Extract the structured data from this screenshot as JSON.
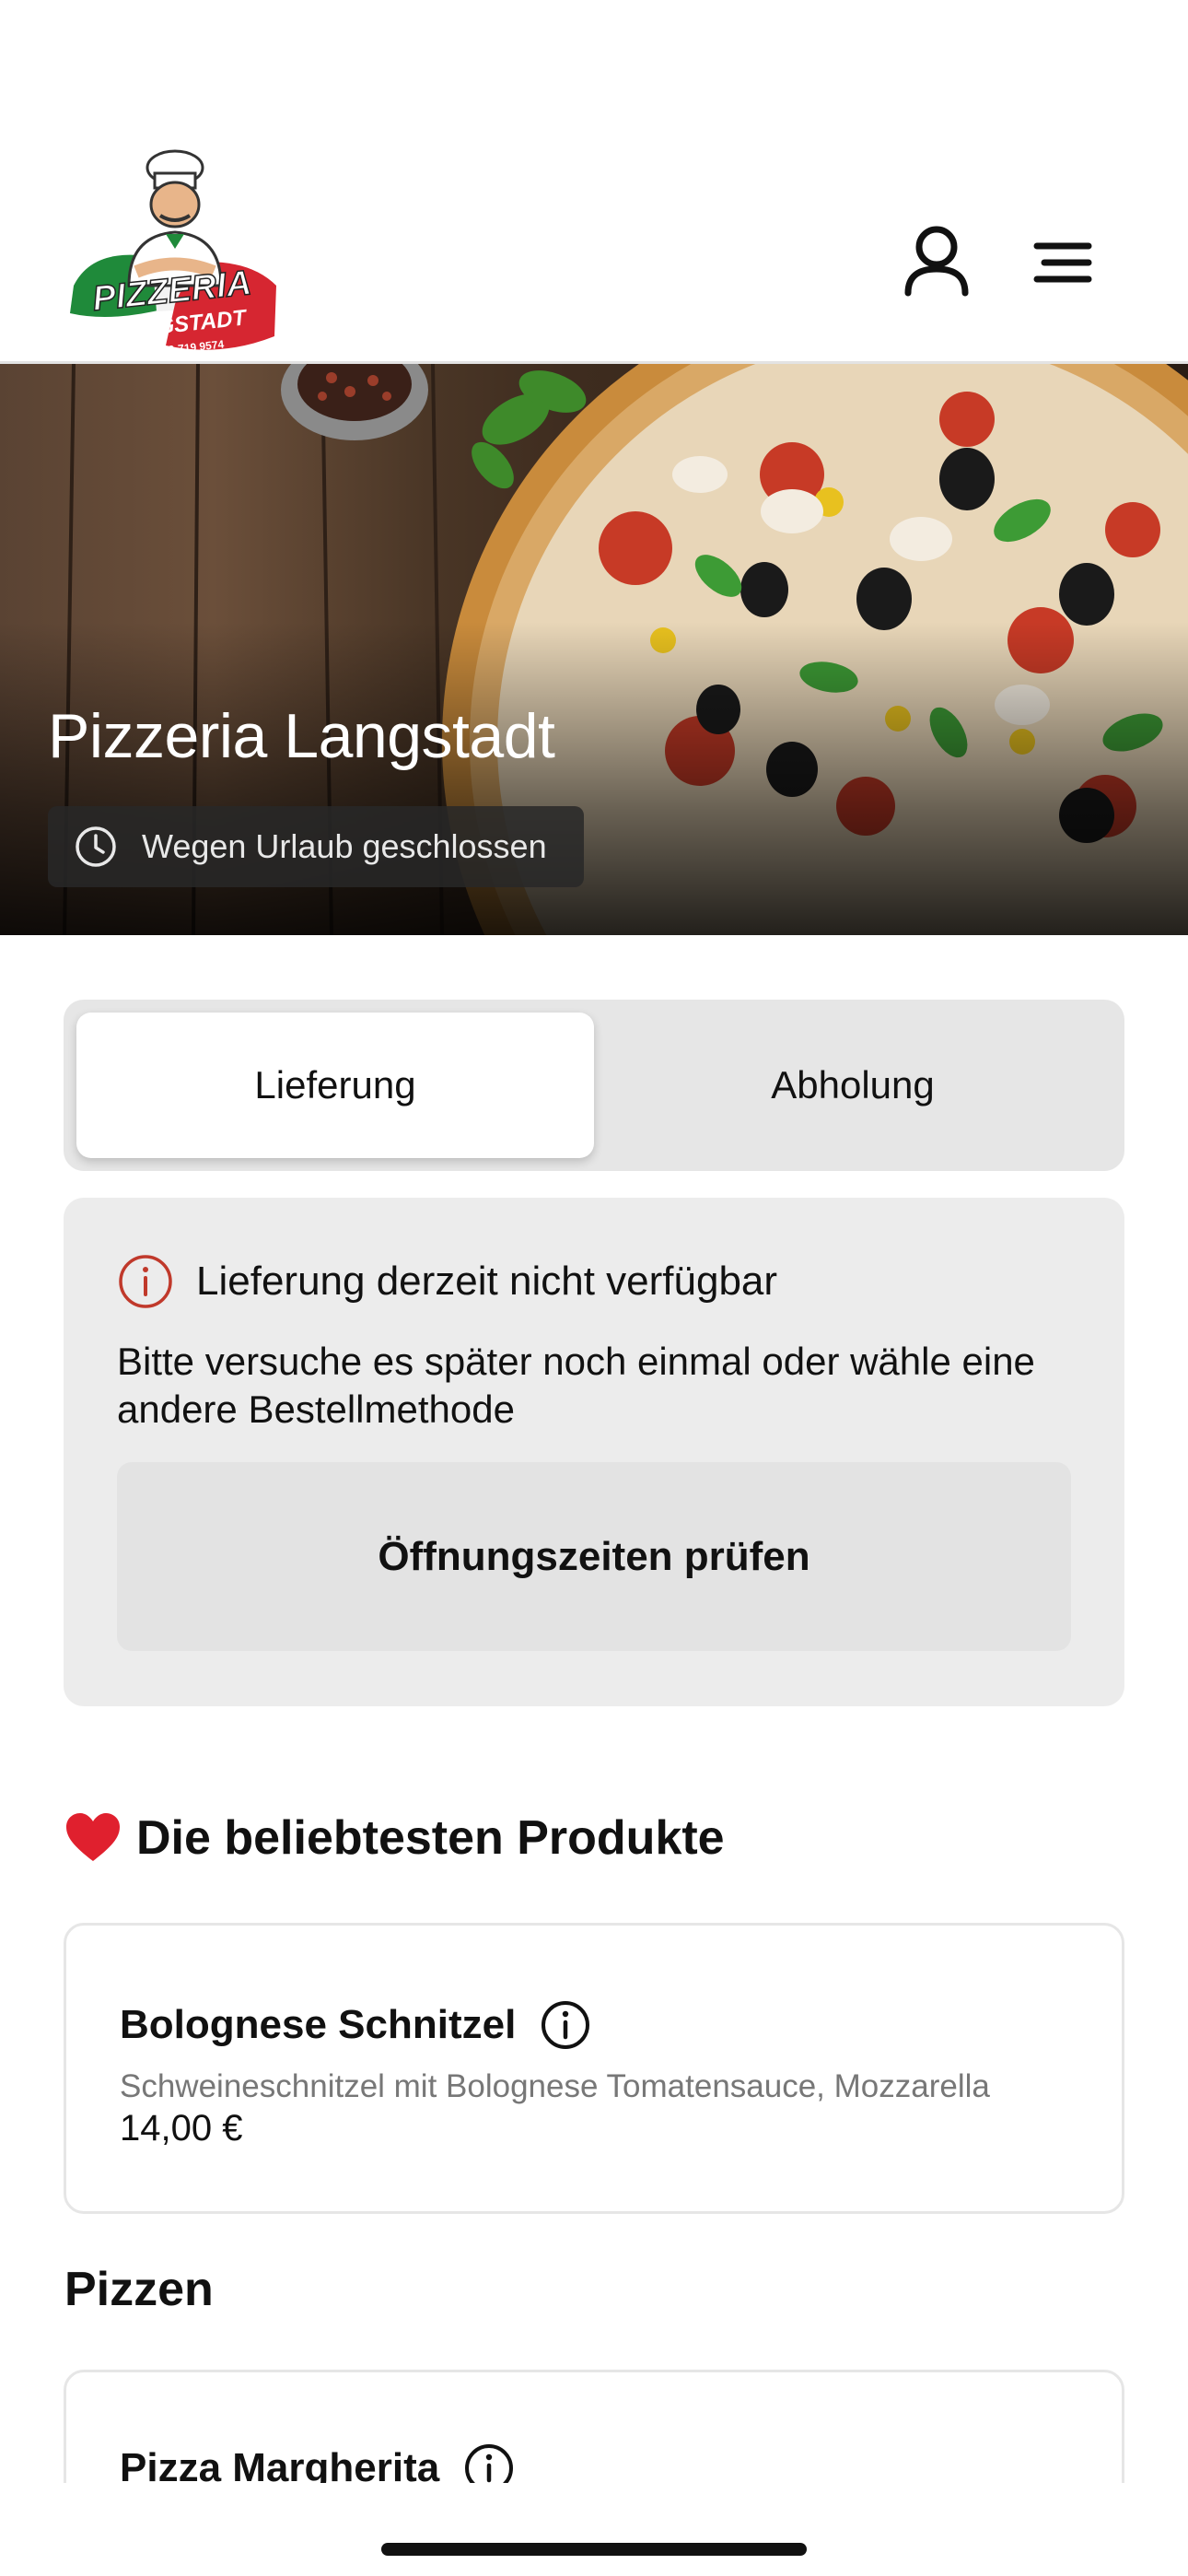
{
  "header": {
    "logo_text_top": "PIZZERIA",
    "logo_text_bottom": "LANGSTADT",
    "logo_phone": "06073-719 9574",
    "icons": [
      "user-icon",
      "menu-icon"
    ]
  },
  "hero": {
    "restaurant_name": "Pizzeria Langstadt",
    "status": "Wegen Urlaub geschlossen",
    "status_icon": "clock-icon"
  },
  "order_mode": {
    "options": [
      {
        "label": "Lieferung",
        "active": true
      },
      {
        "label": "Abholung",
        "active": false
      }
    ]
  },
  "notice": {
    "icon": "alert-circle-icon",
    "title": "Lieferung derzeit nicht verfügbar",
    "text": "Bitte versuche es später noch einmal oder wähle eine andere Bestellmethode",
    "button_label": "Öffnungszeiten prüfen",
    "accent_color": "#c0392b"
  },
  "popular": {
    "title": "Die beliebtesten Produkte",
    "icon": "heart-icon",
    "items": [
      {
        "name": "Bolognese Schnitzel",
        "description": "Schweineschnitzel mit Bolognese Tomatensauce, Mozzarella",
        "price": "14,00 €"
      }
    ]
  },
  "categories": [
    {
      "title": "Pizzen",
      "items": [
        {
          "name": "Pizza Margherita"
        }
      ]
    }
  ]
}
